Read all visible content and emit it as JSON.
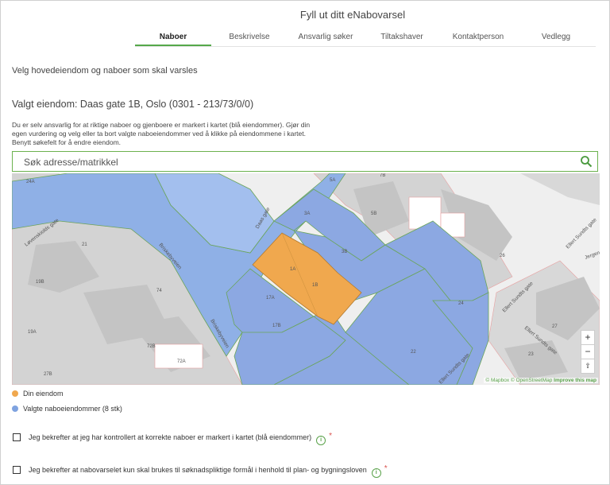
{
  "page": {
    "title": "Fyll ut ditt eNabovarsel"
  },
  "tabs": [
    {
      "label": "Naboer",
      "active": true
    },
    {
      "label": "Beskrivelse",
      "active": false
    },
    {
      "label": "Ansvarlig søker",
      "active": false
    },
    {
      "label": "Tiltakshaver",
      "active": false
    },
    {
      "label": "Kontaktperson",
      "active": false
    },
    {
      "label": "Vedlegg",
      "active": false
    }
  ],
  "main": {
    "heading": "Velg hovedeiendom og naboer som skal varsles",
    "selected_property": "Valgt eiendom: Daas gate 1B, Oslo (0301 - 213/73/0/0)",
    "description": "Du er selv ansvarlig for at riktige naboer og gjenboere er markert i kartet (blå eiendommer). Gjør din egen vurdering og velg eller ta bort valgte naboeiendommer ved å klikke på eiendommene i kartet. Benytt søkefelt for å endre eiendom."
  },
  "search": {
    "placeholder": "Søk adresse/matrikkel",
    "icon": "search-icon"
  },
  "map": {
    "zoom_in": "+",
    "zoom_out": "−",
    "compass": "⇧",
    "attribution": "© Mapbox © OpenStreetMap",
    "improve": "Improve this map",
    "roads": [
      "Løvenskiolds gate",
      "Daas gate",
      "Briskebyveien",
      "Ellert Sundts gate",
      "Jergen"
    ],
    "labels": [
      "24A",
      "21",
      "19B",
      "19A",
      "27B",
      "74",
      "72B",
      "72A",
      "5A",
      "5B",
      "26",
      "27",
      "23",
      "7B",
      "1A",
      "1B",
      "3B",
      "17A",
      "17B",
      "22",
      "24",
      "3A"
    ]
  },
  "legend": [
    {
      "label": "Din eiendom",
      "color": "#f0a84e"
    },
    {
      "label": "Valgte naboeiendommer (8 stk)",
      "color": "#7fa3e0"
    }
  ],
  "confirmations": [
    {
      "text": "Jeg bekrefter at jeg har kontrollert at korrekte naboer er markert i kartet (blå eiendommer)",
      "required_mark": "*"
    },
    {
      "text": "Jeg bekrefter at nabovarselet kun skal brukes til søknadspliktige formål i henhold til plan- og bygningsloven",
      "required_mark": "*"
    }
  ]
}
